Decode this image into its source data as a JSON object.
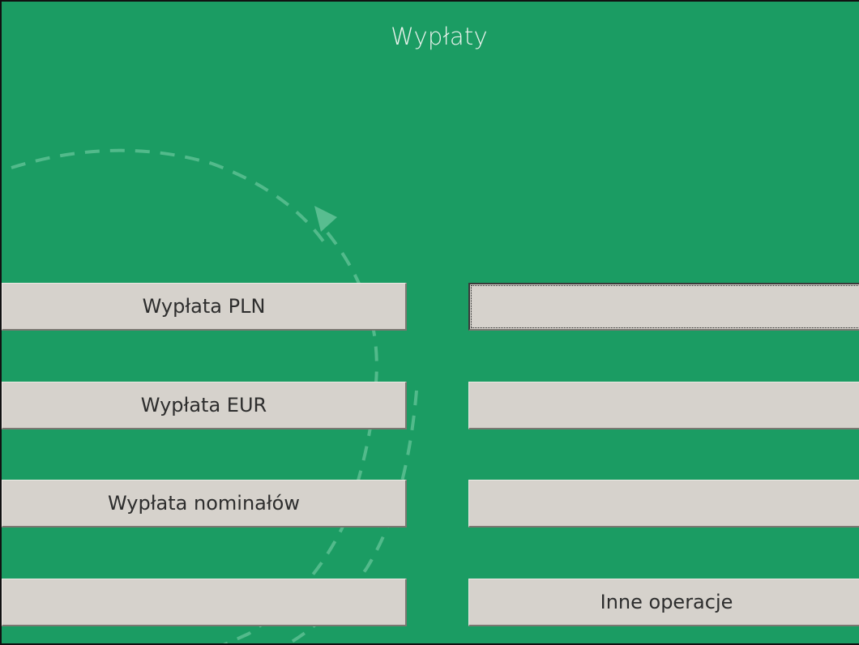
{
  "window": {
    "title": "Wypłaty",
    "background_color": "#1b9c63",
    "button_color": "#d6d2cc"
  },
  "decoration": {
    "description_icon": "dashed-circular-arrow-icon"
  },
  "buttons": {
    "left": [
      {
        "label": "Wypłata PLN"
      },
      {
        "label": "Wypłata EUR"
      },
      {
        "label": "Wypłata nominałów"
      },
      {
        "label": ""
      }
    ],
    "right": [
      {
        "label": ""
      },
      {
        "label": ""
      },
      {
        "label": ""
      },
      {
        "label": "Inne operacje"
      }
    ]
  }
}
